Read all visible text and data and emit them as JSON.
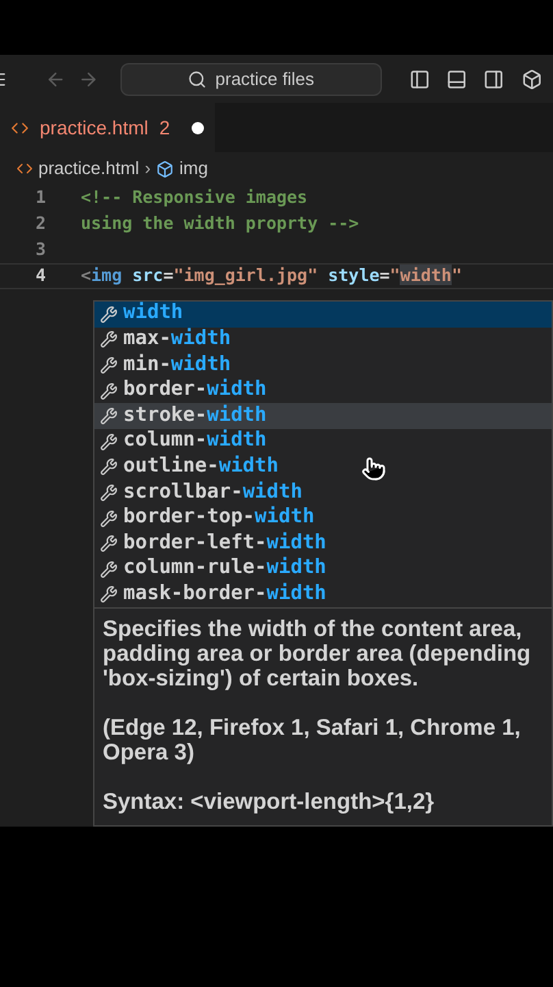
{
  "title_bar": {
    "back_disabled": true,
    "forward_disabled": true,
    "search": {
      "value": "practice files"
    }
  },
  "tabs": [
    {
      "label": "practice.html",
      "problems": "2",
      "modified": true,
      "selected": true
    }
  ],
  "breadcrumbs": [
    {
      "label": "practice.html",
      "kind": "file"
    },
    {
      "label": "img",
      "kind": "element"
    }
  ],
  "breadcrumb_separator": "›",
  "code_lines": [
    {
      "number": "1",
      "current": false,
      "tokens": [
        {
          "text": "<!-- Responsive images",
          "kind": "comment"
        }
      ]
    },
    {
      "number": "2",
      "current": false,
      "tokens": [
        {
          "text": "using the width proprty -->",
          "kind": "comment"
        }
      ]
    },
    {
      "number": "3",
      "current": false
    },
    {
      "number": "4",
      "current": true,
      "tokens": [
        {
          "text": "<",
          "kind": "bracket"
        },
        {
          "text": "img",
          "kind": "tag"
        },
        {
          "text": " src",
          "kind": "attr"
        },
        {
          "text": "=",
          "kind": "plain"
        },
        {
          "text": "\"img_girl.jpg\"",
          "kind": "string"
        },
        {
          "text": " style",
          "kind": "attr"
        },
        {
          "text": "=",
          "kind": "plain"
        },
        {
          "text": "\"",
          "kind": "string"
        },
        {
          "text": "width",
          "kind": "match"
        },
        {
          "text": "\"",
          "kind": "string"
        }
      ]
    }
  ],
  "suggestions": [
    {
      "match": "width",
      "selected": true,
      "hovered": false
    },
    {
      "prefix": "max-",
      "match": "width",
      "selected": false,
      "hovered": false
    },
    {
      "prefix": "min-",
      "match": "width",
      "selected": false,
      "hovered": false
    },
    {
      "prefix": "border-",
      "match": "width",
      "selected": false,
      "hovered": false
    },
    {
      "prefix": "stroke-",
      "match": "width",
      "selected": false,
      "hovered": true
    },
    {
      "prefix": "column-",
      "match": "width",
      "selected": false,
      "hovered": false
    },
    {
      "prefix": "outline-",
      "match": "width",
      "selected": false,
      "hovered": false
    },
    {
      "prefix": "scrollbar-",
      "match": "width",
      "selected": false,
      "hovered": false
    },
    {
      "prefix": "border-top-",
      "match": "width",
      "selected": false,
      "hovered": false
    },
    {
      "prefix": "border-left-",
      "match": "width",
      "selected": false,
      "hovered": false
    },
    {
      "prefix": "column-rule-",
      "match": "width",
      "selected": false,
      "hovered": false
    },
    {
      "prefix": "mask-border-",
      "match": "width",
      "selected": false,
      "hovered": false
    }
  ],
  "details": {
    "description": "Specifies the width of the content area, padding area or border area (depending 'box-sizing') of certain boxes.",
    "browsers": "(Edge 12, Firefox 1, Safari 1, Chrome 1, Opera 3)",
    "syntax": "Syntax: <viewport-length>{1,2}"
  }
}
